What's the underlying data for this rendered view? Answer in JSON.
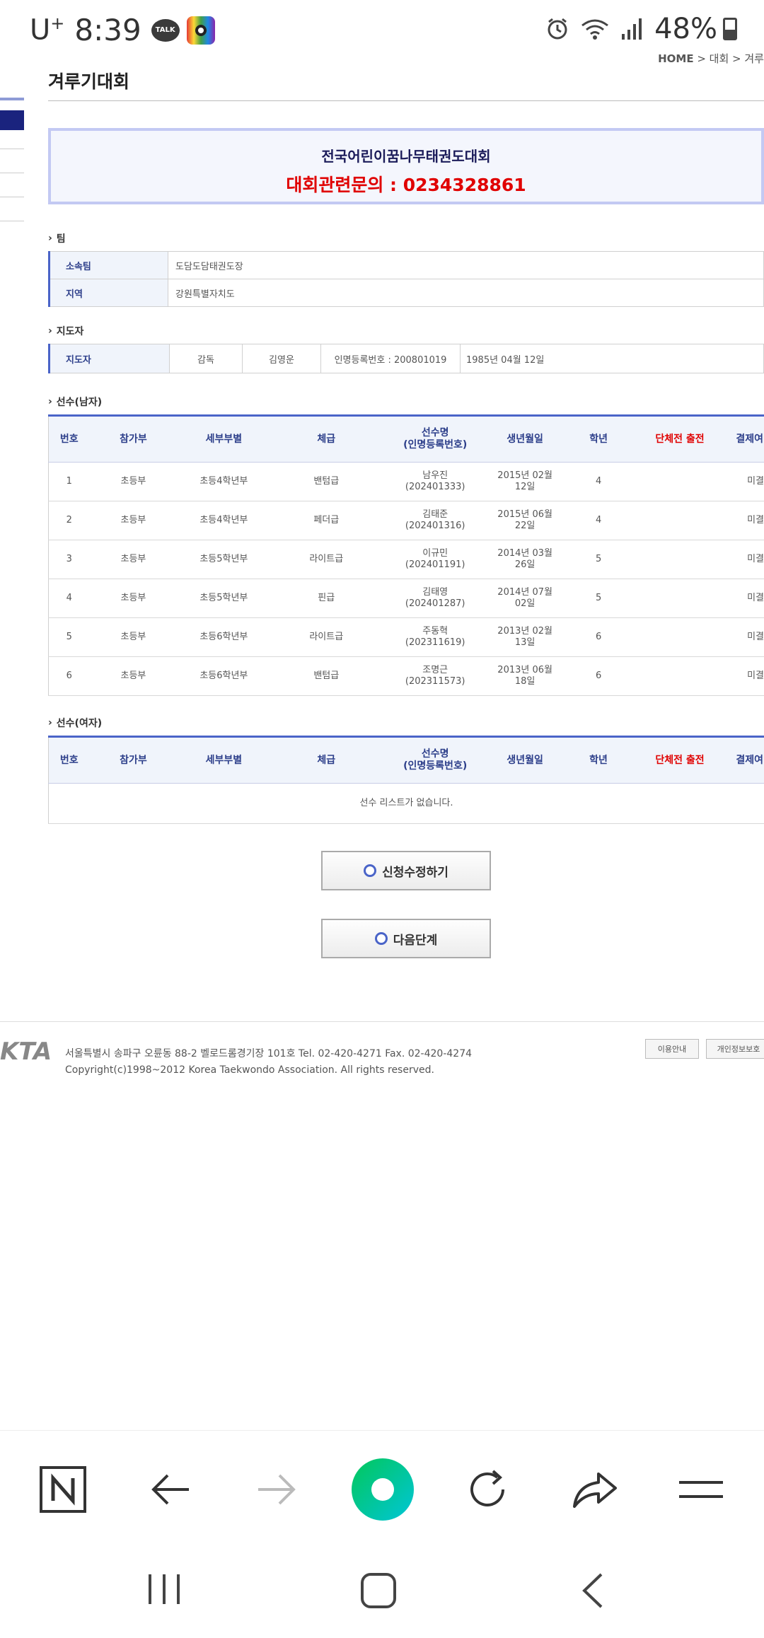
{
  "status_bar": {
    "carrier": "U",
    "carrier_sup": "+",
    "time": "8:39",
    "talk_badge": "TALK",
    "battery": "48%"
  },
  "breadcrumb": {
    "home": "HOME",
    "rest": " > 대회 > 겨루"
  },
  "page_title": "겨루기대회",
  "banner": {
    "title": "전국어린이꿈나무태권도대회",
    "contact": "대회관련문의 : 0234328861"
  },
  "team_section": {
    "heading": "팀",
    "rows": [
      {
        "key": "소속팀",
        "value": "도담도담태권도장"
      },
      {
        "key": "지역",
        "value": "강원특별자치도"
      }
    ]
  },
  "coach_section": {
    "heading": "지도자",
    "key": "지도자",
    "cells": [
      "감독",
      "김영운",
      "인명등록번호 : 200801019",
      "1985년 04월 12일"
    ]
  },
  "male_section": {
    "heading": "선수(남자)",
    "columns": [
      "번호",
      "참가부",
      "세부부별",
      "체급",
      "선수명\n(인명등록번호)",
      "생년월일",
      "학년",
      "단체전 출전",
      "결제여"
    ],
    "rows": [
      {
        "no": "1",
        "div": "초등부",
        "sub": "초등4학년부",
        "weight": "밴텀급",
        "name": "남우진",
        "reg": "(202401333)",
        "birth1": "2015년 02월",
        "birth2": "12일",
        "grade": "4",
        "team": "",
        "pay": "미결"
      },
      {
        "no": "2",
        "div": "초등부",
        "sub": "초등4학년부",
        "weight": "페더급",
        "name": "김태준",
        "reg": "(202401316)",
        "birth1": "2015년 06월",
        "birth2": "22일",
        "grade": "4",
        "team": "",
        "pay": "미결"
      },
      {
        "no": "3",
        "div": "초등부",
        "sub": "초등5학년부",
        "weight": "라이트급",
        "name": "이규민",
        "reg": "(202401191)",
        "birth1": "2014년 03월",
        "birth2": "26일",
        "grade": "5",
        "team": "",
        "pay": "미결"
      },
      {
        "no": "4",
        "div": "초등부",
        "sub": "초등5학년부",
        "weight": "핀급",
        "name": "김태영",
        "reg": "(202401287)",
        "birth1": "2014년 07월",
        "birth2": "02일",
        "grade": "5",
        "team": "",
        "pay": "미결"
      },
      {
        "no": "5",
        "div": "초등부",
        "sub": "초등6학년부",
        "weight": "라이트급",
        "name": "주동혁",
        "reg": "(202311619)",
        "birth1": "2013년 02월",
        "birth2": "13일",
        "grade": "6",
        "team": "",
        "pay": "미결"
      },
      {
        "no": "6",
        "div": "초등부",
        "sub": "초등6학년부",
        "weight": "밴텀급",
        "name": "조명근",
        "reg": "(202311573)",
        "birth1": "2013년 06월",
        "birth2": "18일",
        "grade": "6",
        "team": "",
        "pay": "미결"
      }
    ]
  },
  "female_section": {
    "heading": "선수(여자)",
    "columns": [
      "번호",
      "참가부",
      "세부부별",
      "체급",
      "선수명\n(인명등록번호)",
      "생년월일",
      "학년",
      "단체전 출전",
      "결제여"
    ],
    "empty_message": "선수 리스트가 없습니다."
  },
  "buttons": {
    "edit": "신청수정하기",
    "next": "다음단계"
  },
  "footer": {
    "logo": "KTA",
    "address": "서울특별시 송파구 오륜동 88-2 벨로드롬경기장 101호 Tel. 02-420-4271 Fax. 02-420-4274",
    "copyright": "Copyright(c)1998~2012 Korea Taekwondo Association. All rights reserved.",
    "btn_usage": "이용안내",
    "btn_privacy": "개인정보보호"
  },
  "colors": {
    "accent_blue": "#4a64c8",
    "dark_navy": "#1a237e",
    "red": "#e00000",
    "naver_green": "#03c75a"
  },
  "browser_toolbar": {
    "icons": [
      "naver-home-icon",
      "back-arrow-icon",
      "forward-arrow-icon",
      "green-dot-icon",
      "refresh-icon",
      "share-icon",
      "menu-icon"
    ]
  },
  "system_nav": {
    "icons": [
      "recent-apps-icon",
      "home-icon",
      "back-icon"
    ]
  }
}
